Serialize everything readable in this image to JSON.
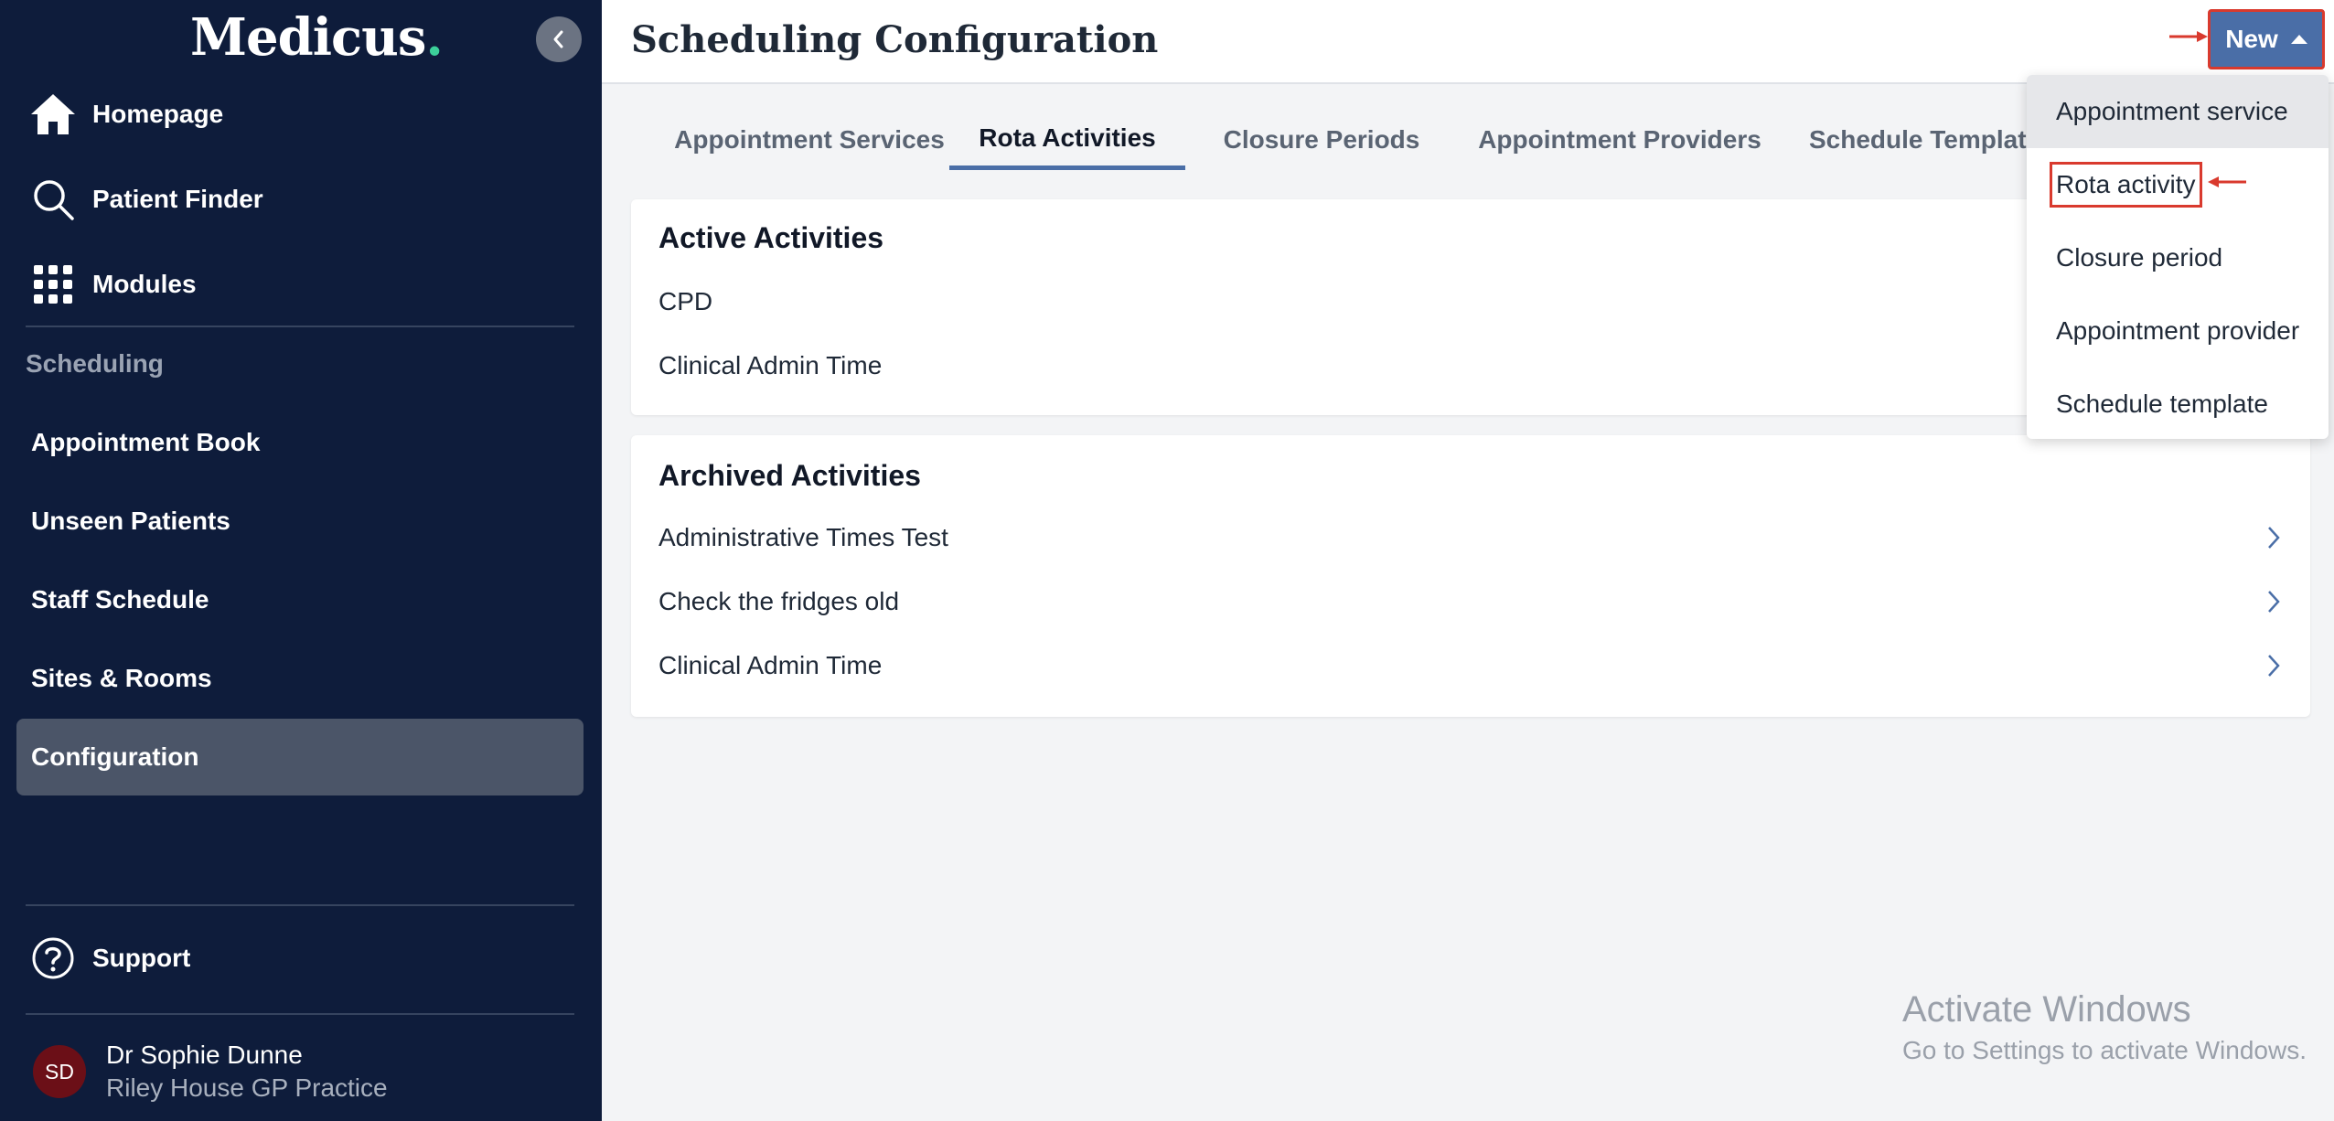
{
  "app": {
    "brand": "Medicus",
    "brand_dot": ".",
    "page_title": "Scheduling Configuration"
  },
  "sidebar": {
    "main_items": [
      {
        "label": "Homepage",
        "icon": "home-icon"
      },
      {
        "label": "Patient Finder",
        "icon": "search-icon"
      },
      {
        "label": "Modules",
        "icon": "grid-icon"
      }
    ],
    "section_heading": "Scheduling",
    "sub_items": [
      {
        "label": "Appointment Book"
      },
      {
        "label": "Unseen Patients"
      },
      {
        "label": "Staff Schedule"
      },
      {
        "label": "Sites & Rooms"
      },
      {
        "label": "Configuration",
        "active": true
      }
    ],
    "support_label": "Support",
    "user": {
      "initials": "SD",
      "name": "Dr Sophie Dunne",
      "practice": "Riley House GP Practice"
    }
  },
  "header": {
    "new_button_label": "New"
  },
  "tabs": [
    {
      "label": "Appointment Services"
    },
    {
      "label": "Rota Activities",
      "active": true
    },
    {
      "label": "Closure Periods"
    },
    {
      "label": "Appointment Providers"
    },
    {
      "label": "Schedule Templat"
    }
  ],
  "active_activities": {
    "title": "Active Activities",
    "items": [
      "CPD",
      "Clinical Admin Time"
    ]
  },
  "archived_activities": {
    "title": "Archived Activities",
    "items": [
      "Administrative Times Test",
      "Check the fridges old",
      "Clinical Admin Time"
    ]
  },
  "new_menu": {
    "items": [
      {
        "label": "Appointment service"
      },
      {
        "label": "Rota activity"
      },
      {
        "label": "Closure period"
      },
      {
        "label": "Appointment provider"
      },
      {
        "label": "Schedule template"
      }
    ]
  },
  "watermark": {
    "line1": "Activate Windows",
    "line2": "Go to Settings to activate Windows."
  },
  "colors": {
    "sidebar_bg": "#0e1c3b",
    "accent": "#4a6ea7",
    "annotation_red": "#d93a2e",
    "avatar_bg": "#6b0f17",
    "brand_dot": "#3ccf9a"
  }
}
